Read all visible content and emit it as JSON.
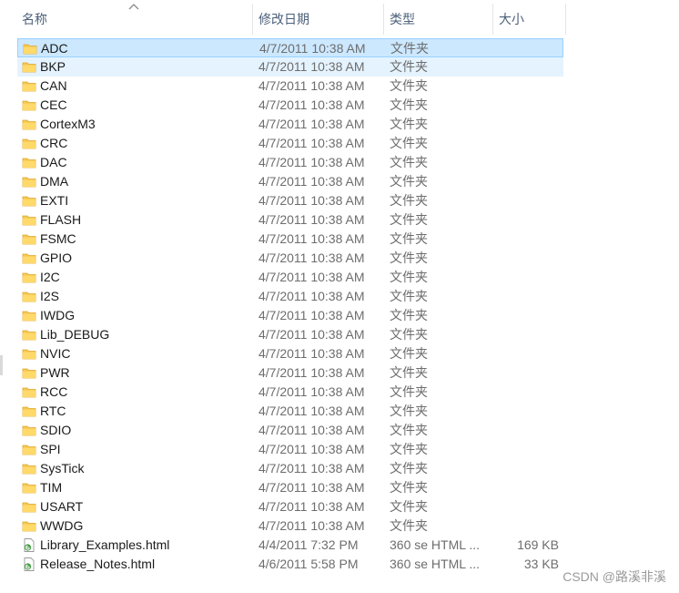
{
  "columns": {
    "name": "名称",
    "date": "修改日期",
    "type": "类型",
    "size": "大小"
  },
  "files": [
    {
      "name": "ADC",
      "date": "4/7/2011 10:38 AM",
      "type": "文件夹",
      "size": "",
      "kind": "folder",
      "state": "selected"
    },
    {
      "name": "BKP",
      "date": "4/7/2011 10:38 AM",
      "type": "文件夹",
      "size": "",
      "kind": "folder",
      "state": "hover"
    },
    {
      "name": "CAN",
      "date": "4/7/2011 10:38 AM",
      "type": "文件夹",
      "size": "",
      "kind": "folder"
    },
    {
      "name": "CEC",
      "date": "4/7/2011 10:38 AM",
      "type": "文件夹",
      "size": "",
      "kind": "folder"
    },
    {
      "name": "CortexM3",
      "date": "4/7/2011 10:38 AM",
      "type": "文件夹",
      "size": "",
      "kind": "folder"
    },
    {
      "name": "CRC",
      "date": "4/7/2011 10:38 AM",
      "type": "文件夹",
      "size": "",
      "kind": "folder"
    },
    {
      "name": "DAC",
      "date": "4/7/2011 10:38 AM",
      "type": "文件夹",
      "size": "",
      "kind": "folder"
    },
    {
      "name": "DMA",
      "date": "4/7/2011 10:38 AM",
      "type": "文件夹",
      "size": "",
      "kind": "folder"
    },
    {
      "name": "EXTI",
      "date": "4/7/2011 10:38 AM",
      "type": "文件夹",
      "size": "",
      "kind": "folder"
    },
    {
      "name": "FLASH",
      "date": "4/7/2011 10:38 AM",
      "type": "文件夹",
      "size": "",
      "kind": "folder"
    },
    {
      "name": "FSMC",
      "date": "4/7/2011 10:38 AM",
      "type": "文件夹",
      "size": "",
      "kind": "folder"
    },
    {
      "name": "GPIO",
      "date": "4/7/2011 10:38 AM",
      "type": "文件夹",
      "size": "",
      "kind": "folder"
    },
    {
      "name": "I2C",
      "date": "4/7/2011 10:38 AM",
      "type": "文件夹",
      "size": "",
      "kind": "folder"
    },
    {
      "name": "I2S",
      "date": "4/7/2011 10:38 AM",
      "type": "文件夹",
      "size": "",
      "kind": "folder"
    },
    {
      "name": "IWDG",
      "date": "4/7/2011 10:38 AM",
      "type": "文件夹",
      "size": "",
      "kind": "folder"
    },
    {
      "name": "Lib_DEBUG",
      "date": "4/7/2011 10:38 AM",
      "type": "文件夹",
      "size": "",
      "kind": "folder"
    },
    {
      "name": "NVIC",
      "date": "4/7/2011 10:38 AM",
      "type": "文件夹",
      "size": "",
      "kind": "folder"
    },
    {
      "name": "PWR",
      "date": "4/7/2011 10:38 AM",
      "type": "文件夹",
      "size": "",
      "kind": "folder"
    },
    {
      "name": "RCC",
      "date": "4/7/2011 10:38 AM",
      "type": "文件夹",
      "size": "",
      "kind": "folder"
    },
    {
      "name": "RTC",
      "date": "4/7/2011 10:38 AM",
      "type": "文件夹",
      "size": "",
      "kind": "folder"
    },
    {
      "name": "SDIO",
      "date": "4/7/2011 10:38 AM",
      "type": "文件夹",
      "size": "",
      "kind": "folder"
    },
    {
      "name": "SPI",
      "date": "4/7/2011 10:38 AM",
      "type": "文件夹",
      "size": "",
      "kind": "folder"
    },
    {
      "name": "SysTick",
      "date": "4/7/2011 10:38 AM",
      "type": "文件夹",
      "size": "",
      "kind": "folder"
    },
    {
      "name": "TIM",
      "date": "4/7/2011 10:38 AM",
      "type": "文件夹",
      "size": "",
      "kind": "folder"
    },
    {
      "name": "USART",
      "date": "4/7/2011 10:38 AM",
      "type": "文件夹",
      "size": "",
      "kind": "folder"
    },
    {
      "name": "WWDG",
      "date": "4/7/2011 10:38 AM",
      "type": "文件夹",
      "size": "",
      "kind": "folder"
    },
    {
      "name": "Library_Examples.html",
      "date": "4/4/2011 7:32 PM",
      "type": "360 se HTML ...",
      "size": "169 KB",
      "kind": "html"
    },
    {
      "name": "Release_Notes.html",
      "date": "4/6/2011 5:58 PM",
      "type": "360 se HTML ...",
      "size": "33 KB",
      "kind": "html"
    }
  ],
  "colors": {
    "selected_bg": "#cce8ff",
    "selected_border": "#99d1ff",
    "hover_bg": "#e5f3ff",
    "folder": "#f6c74f",
    "folder_dark": "#e0a82e",
    "html_icon": "#3a9a3a"
  },
  "icons": {
    "folder": "folder-icon",
    "html": "html-file-icon",
    "sort": "sort-ascending-icon"
  },
  "watermark": "CSDN @路溪非溪"
}
